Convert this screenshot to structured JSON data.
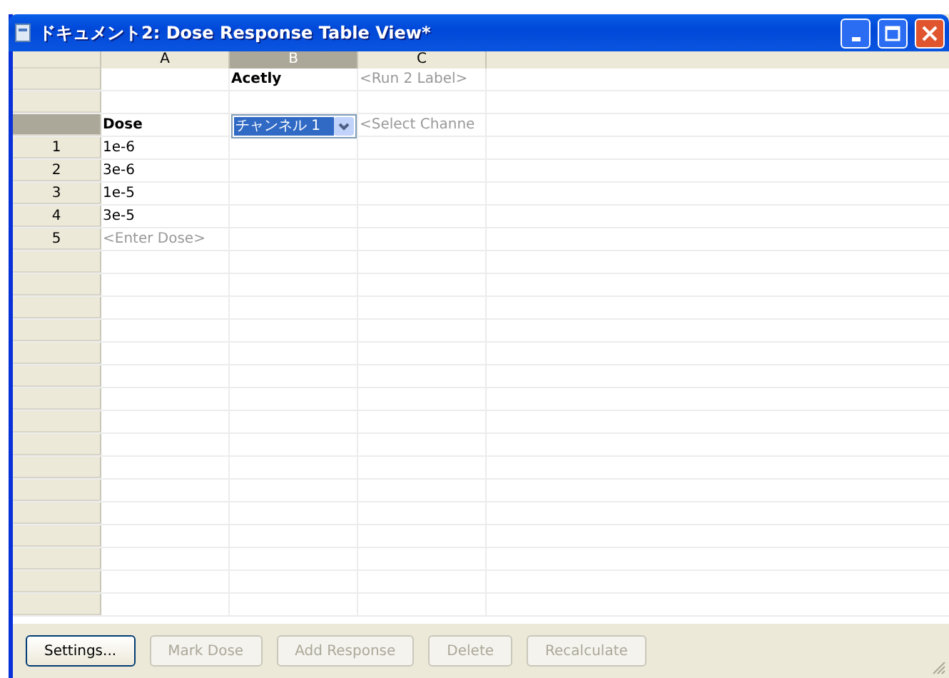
{
  "window": {
    "title": "ドキュメント2: Dose Response Table View*"
  },
  "columns": [
    {
      "label": "A",
      "selected": false
    },
    {
      "label": "B",
      "selected": true
    },
    {
      "label": "C",
      "selected": false
    }
  ],
  "rows": [
    {
      "header": "",
      "selected": false,
      "cells": [
        {
          "kind": "empty"
        },
        {
          "kind": "bold",
          "text": "Acetly"
        },
        {
          "kind": "hint",
          "text": "<Run 2 Label>"
        }
      ]
    },
    {
      "header": "",
      "selected": false,
      "cells": [
        {
          "kind": "empty"
        },
        {
          "kind": "empty"
        },
        {
          "kind": "empty"
        }
      ]
    },
    {
      "header": "",
      "selected": true,
      "cells": [
        {
          "kind": "bold",
          "text": "Dose"
        },
        {
          "kind": "dropdown",
          "text": "チャンネル 1"
        },
        {
          "kind": "hint",
          "text": "<Select Channe"
        }
      ]
    },
    {
      "header": "1",
      "selected": false,
      "cells": [
        {
          "kind": "normal",
          "text": "1e-6"
        },
        {
          "kind": "empty"
        },
        {
          "kind": "empty"
        }
      ]
    },
    {
      "header": "2",
      "selected": false,
      "cells": [
        {
          "kind": "normal",
          "text": "3e-6"
        },
        {
          "kind": "empty"
        },
        {
          "kind": "empty"
        }
      ]
    },
    {
      "header": "3",
      "selected": false,
      "cells": [
        {
          "kind": "normal",
          "text": "1e-5"
        },
        {
          "kind": "empty"
        },
        {
          "kind": "empty"
        }
      ]
    },
    {
      "header": "4",
      "selected": false,
      "cells": [
        {
          "kind": "normal",
          "text": "3e-5"
        },
        {
          "kind": "empty"
        },
        {
          "kind": "empty"
        }
      ]
    },
    {
      "header": "5",
      "selected": false,
      "cells": [
        {
          "kind": "hint",
          "text": "<Enter Dose>"
        },
        {
          "kind": "empty"
        },
        {
          "kind": "empty"
        }
      ]
    }
  ],
  "buttons": [
    {
      "label": "Settings...",
      "disabled": false
    },
    {
      "label": "Mark Dose",
      "disabled": true
    },
    {
      "label": "Add Response",
      "disabled": true
    },
    {
      "label": "Delete",
      "disabled": true
    },
    {
      "label": "Recalculate",
      "disabled": true
    }
  ]
}
